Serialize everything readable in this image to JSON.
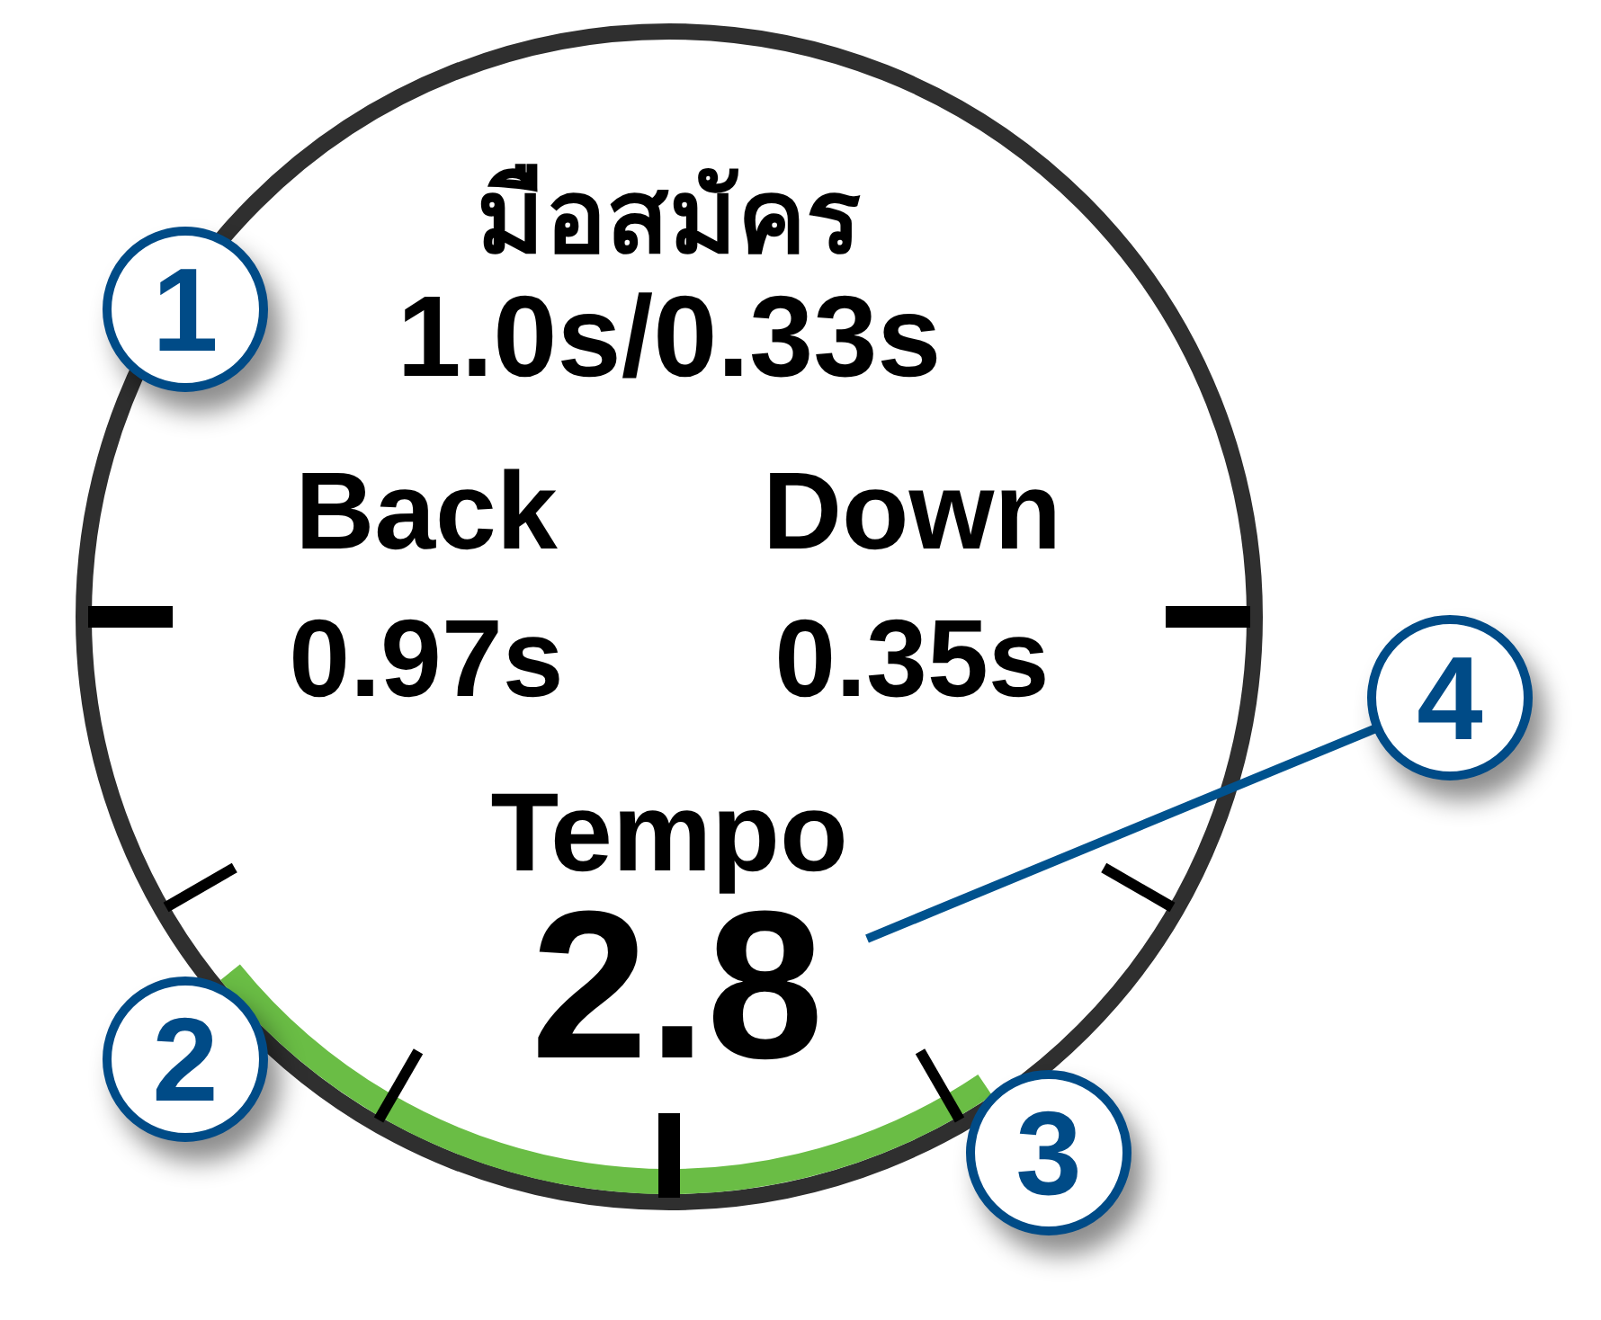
{
  "watch_face": {
    "title": "มือสมัคร",
    "target": "1.0s/0.33s",
    "metrics": [
      {
        "label": "Back",
        "value": "0.97s"
      },
      {
        "label": "Down",
        "value": "0.35s"
      }
    ],
    "tempo": {
      "label": "Tempo",
      "value": "2.8"
    }
  },
  "callouts": [
    "1",
    "2",
    "3",
    "4"
  ]
}
